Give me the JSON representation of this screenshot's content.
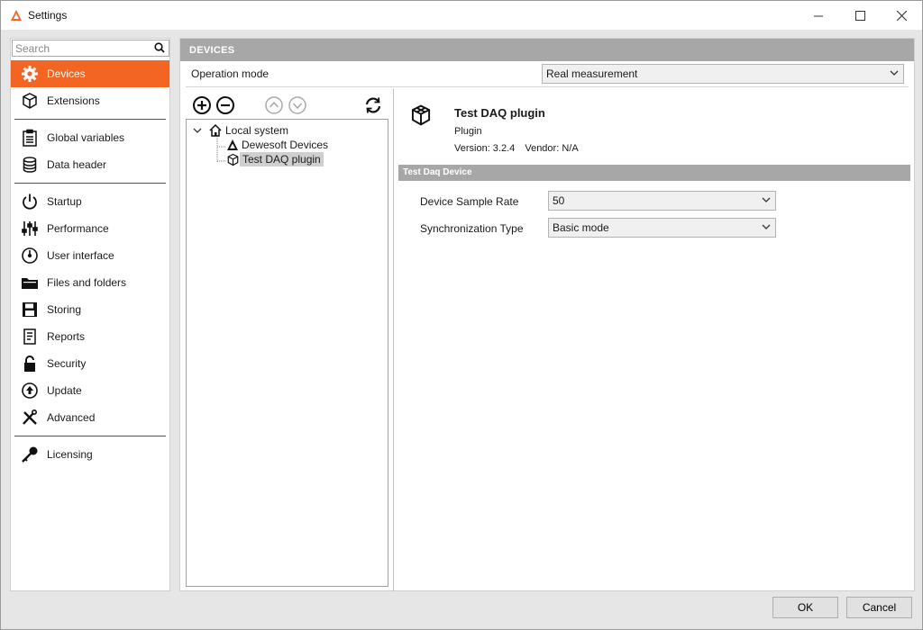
{
  "window": {
    "title": "Settings",
    "accent_color": "#f26522"
  },
  "sidebar": {
    "search_placeholder": "Search",
    "items": [
      {
        "label": "Devices",
        "icon": "gear-icon",
        "active": true
      },
      {
        "label": "Extensions",
        "icon": "cube-icon"
      },
      {
        "label": "Global variables",
        "icon": "clipboard-icon"
      },
      {
        "label": "Data header",
        "icon": "database-icon"
      },
      {
        "label": "Startup",
        "icon": "power-icon"
      },
      {
        "label": "Performance",
        "icon": "sliders-icon"
      },
      {
        "label": "User interface",
        "icon": "gauge-icon"
      },
      {
        "label": "Files and folders",
        "icon": "folder-icon"
      },
      {
        "label": "Storing",
        "icon": "floppy-icon"
      },
      {
        "label": "Reports",
        "icon": "report-icon"
      },
      {
        "label": "Security",
        "icon": "lock-icon"
      },
      {
        "label": "Update",
        "icon": "upload-icon"
      },
      {
        "label": "Advanced",
        "icon": "tools-icon"
      },
      {
        "label": "Licensing",
        "icon": "key-icon"
      }
    ]
  },
  "devices": {
    "header": "DEVICES",
    "operation_mode_label": "Operation mode",
    "operation_mode_value": "Real measurement",
    "tree": {
      "root": "Local system",
      "children": [
        "Dewesoft Devices",
        "Test DAQ plugin"
      ],
      "selected": "Test DAQ plugin"
    },
    "plugin": {
      "name": "Test DAQ plugin",
      "type": "Plugin",
      "version": "Version: 3.2.4",
      "vendor": "Vendor: N/A"
    },
    "device_section": "Test Daq Device",
    "fields": {
      "sample_rate_label": "Device Sample Rate",
      "sample_rate_value": "50",
      "sync_label": "Synchronization Type",
      "sync_value": "Basic mode"
    }
  },
  "footer": {
    "ok_label": "OK",
    "cancel_label": "Cancel"
  }
}
